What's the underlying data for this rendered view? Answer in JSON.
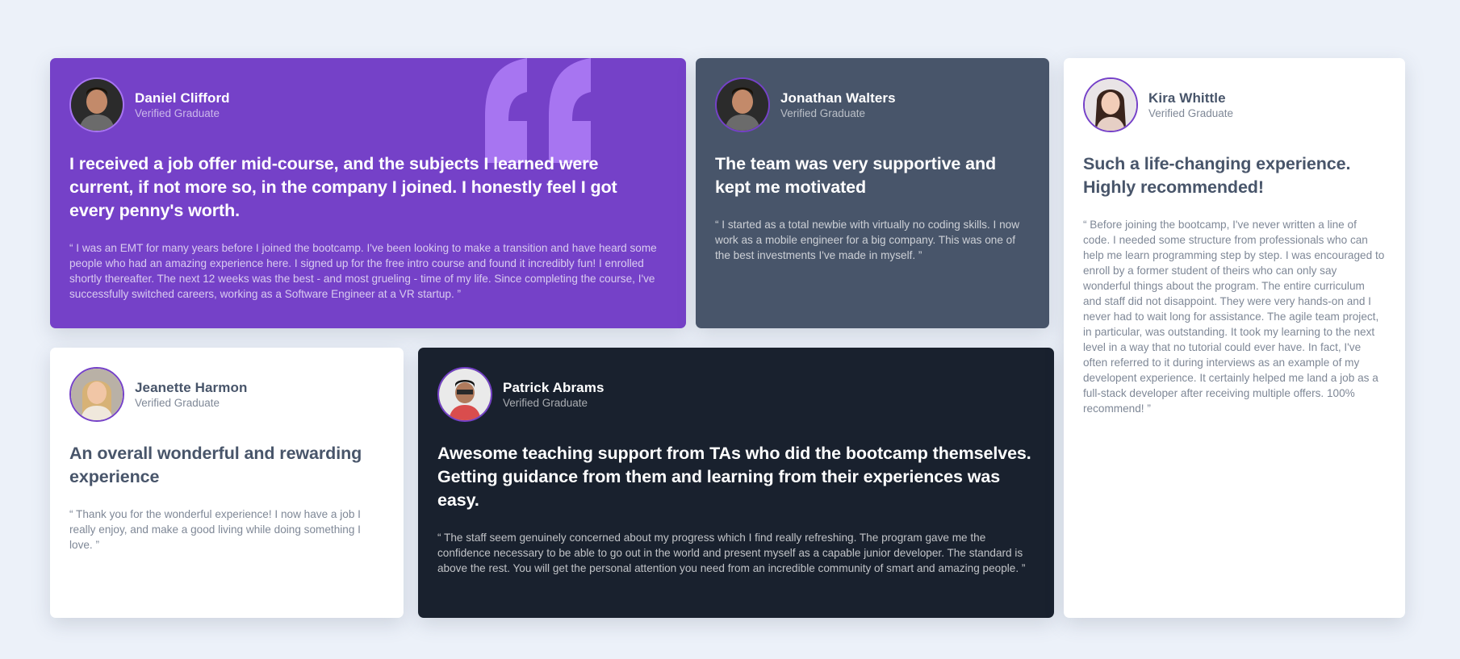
{
  "colors": {
    "page_background": "#ECF1F9",
    "purple": "#7541C8",
    "slate": "#48556A",
    "white": "#FFFFFF",
    "dark": "#19212E",
    "quote_mark": "#A775F1"
  },
  "testimonials": [
    {
      "name": "Daniel Clifford",
      "role": "Verified Graduate",
      "headline": "I received a job offer mid-course, and the subjects I learned were current, if not more so, in the company I joined. I honestly feel I got every penny's worth.",
      "body": "“ I was an EMT for many years before I joined the bootcamp. I've been looking to make a transition and have heard some people who had an amazing experience here. I signed up for the free intro course and found it incredibly fun! I enrolled shortly thereafter. The next 12 weeks was the best - and most grueling - time of my life. Since completing the course, I've successfully switched careers, working as a Software Engineer at a VR startup. ”",
      "theme": "purple",
      "icon": "quotation-mark-icon"
    },
    {
      "name": "Jonathan Walters",
      "role": "Verified Graduate",
      "headline": "The team was very supportive and kept me motivated",
      "body": "“ I started as a total newbie with virtually no coding skills. I now work as a mobile engineer for a big company. This was one of the best investments I've made in myself. ”",
      "theme": "slate"
    },
    {
      "name": "Jeanette Harmon",
      "role": "Verified Graduate",
      "headline": "An overall wonderful and rewarding experience",
      "body": "“ Thank you for the wonderful experience! I now have a job I really enjoy, and make a good living while doing something I love. ”",
      "theme": "white"
    },
    {
      "name": "Patrick Abrams",
      "role": "Verified Graduate",
      "headline": "Awesome teaching support from TAs who did the bootcamp themselves. Getting guidance from them and learning from their experiences was easy.",
      "body": "“ The staff seem genuinely concerned about my progress which I find really refreshing. The program gave me the confidence necessary to be able to go out in the world and present myself as a capable junior developer. The standard is above the rest. You will get the personal attention you need from an incredible community of smart and amazing people. ”",
      "theme": "dark"
    },
    {
      "name": "Kira Whittle",
      "role": "Verified Graduate",
      "headline": "Such a life-changing experience. Highly recommended!",
      "body": "“ Before joining the bootcamp, I've never written a line of code. I needed some structure from professionals who can help me learn programming step by step. I was encouraged to enroll by a former student of theirs who can only say wonderful things about the program. The entire curriculum and staff did not disappoint. They were very hands-on and I never had to wait long for assistance. The agile team project, in particular, was outstanding. It took my learning to the next level in a way that no tutorial could ever have. In fact, I've often referred to it during interviews as an example of my developent experience. It certainly helped me land a job as a full-stack developer after receiving multiple offers. 100% recommend! ”",
      "theme": "white"
    }
  ]
}
